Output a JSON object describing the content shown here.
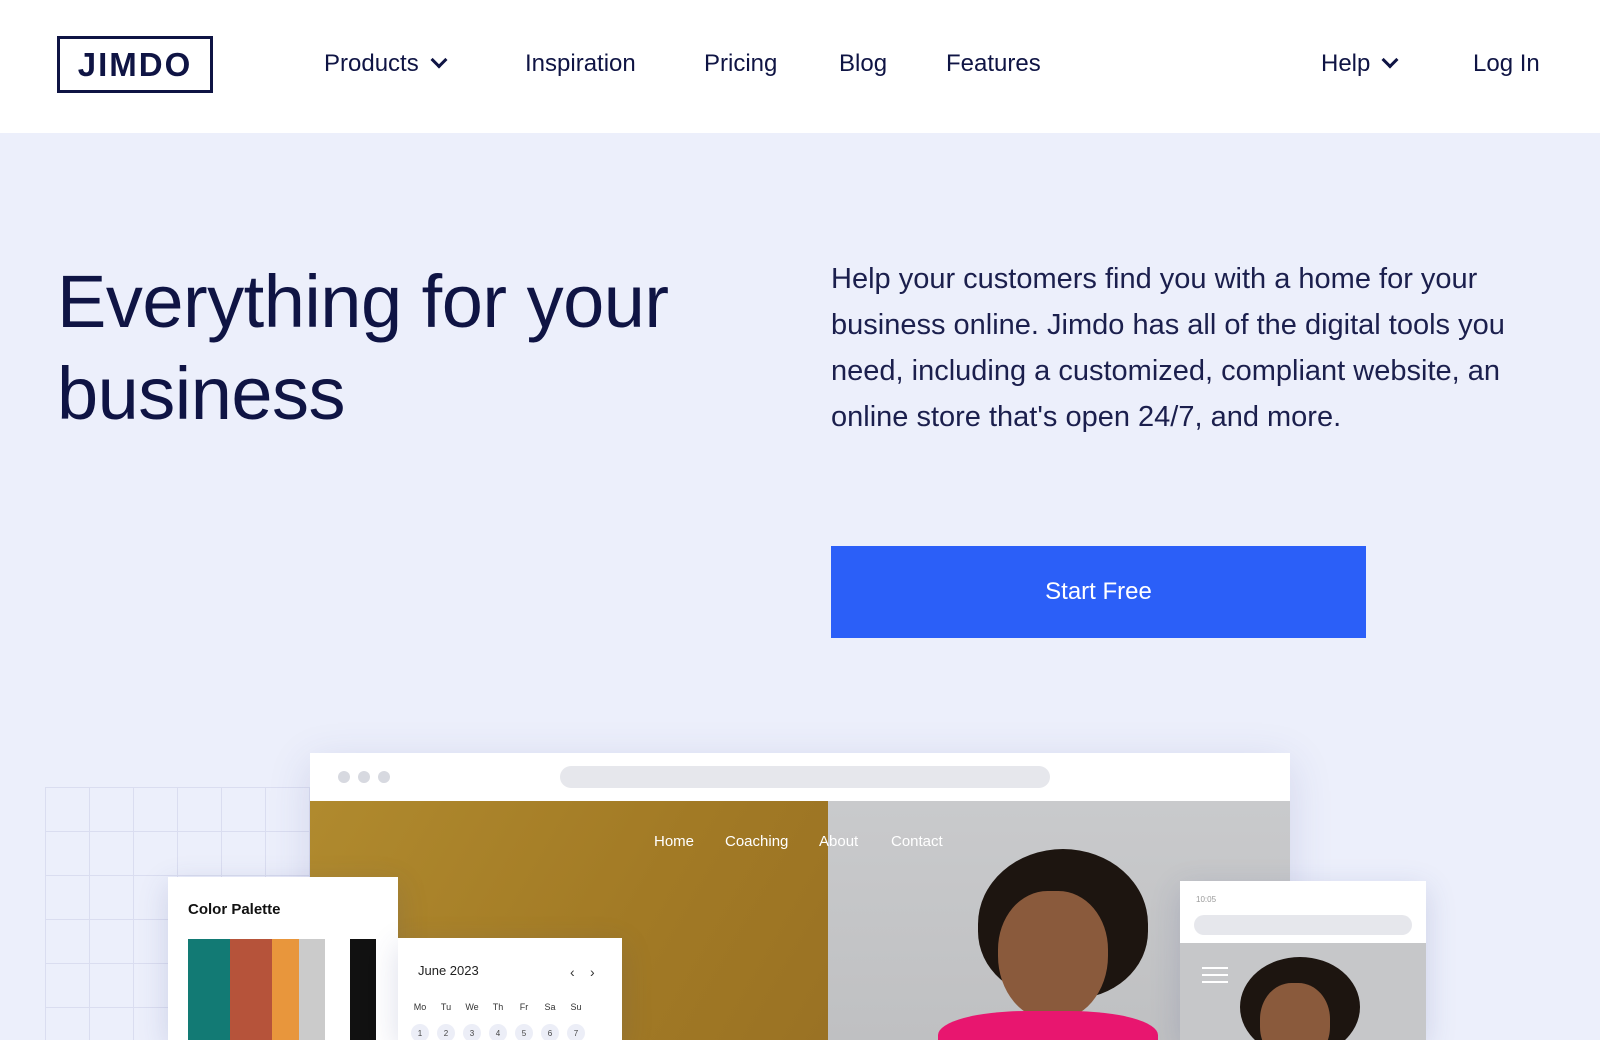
{
  "header": {
    "logo_text": "JIMDO",
    "nav": {
      "products": "Products",
      "inspiration": "Inspiration",
      "pricing": "Pricing",
      "blog": "Blog",
      "features": "Features",
      "help": "Help",
      "login": "Log In"
    }
  },
  "hero": {
    "title": "Everything for your business",
    "description": "Help your customers find you with a home for your business online. Jimdo has all of the digital tools you need, including a customized, compliant website, an online store that's open 24/7, and more.",
    "cta_label": "Start Free"
  },
  "illustration": {
    "site_nav": [
      "Home",
      "Coaching",
      "About",
      "Contact"
    ],
    "palette": {
      "title": "Color Palette",
      "colors": [
        "#127a74",
        "#b6533a",
        "#e8963c",
        "#cbcbcb",
        "#111111"
      ]
    },
    "calendar": {
      "title": "June 2023",
      "prev_icon": "‹",
      "next_icon": "›",
      "days": [
        "Mo",
        "Tu",
        "We",
        "Th",
        "Fr",
        "Sa",
        "Su"
      ],
      "dates": [
        "1",
        "2",
        "3",
        "4",
        "5",
        "6",
        "7"
      ]
    },
    "mobile": {
      "status_time": "10:05"
    }
  },
  "colors": {
    "brand_navy": "#0f1444",
    "cta_blue": "#2b5ff8",
    "hero_bg": "#eceffb"
  }
}
